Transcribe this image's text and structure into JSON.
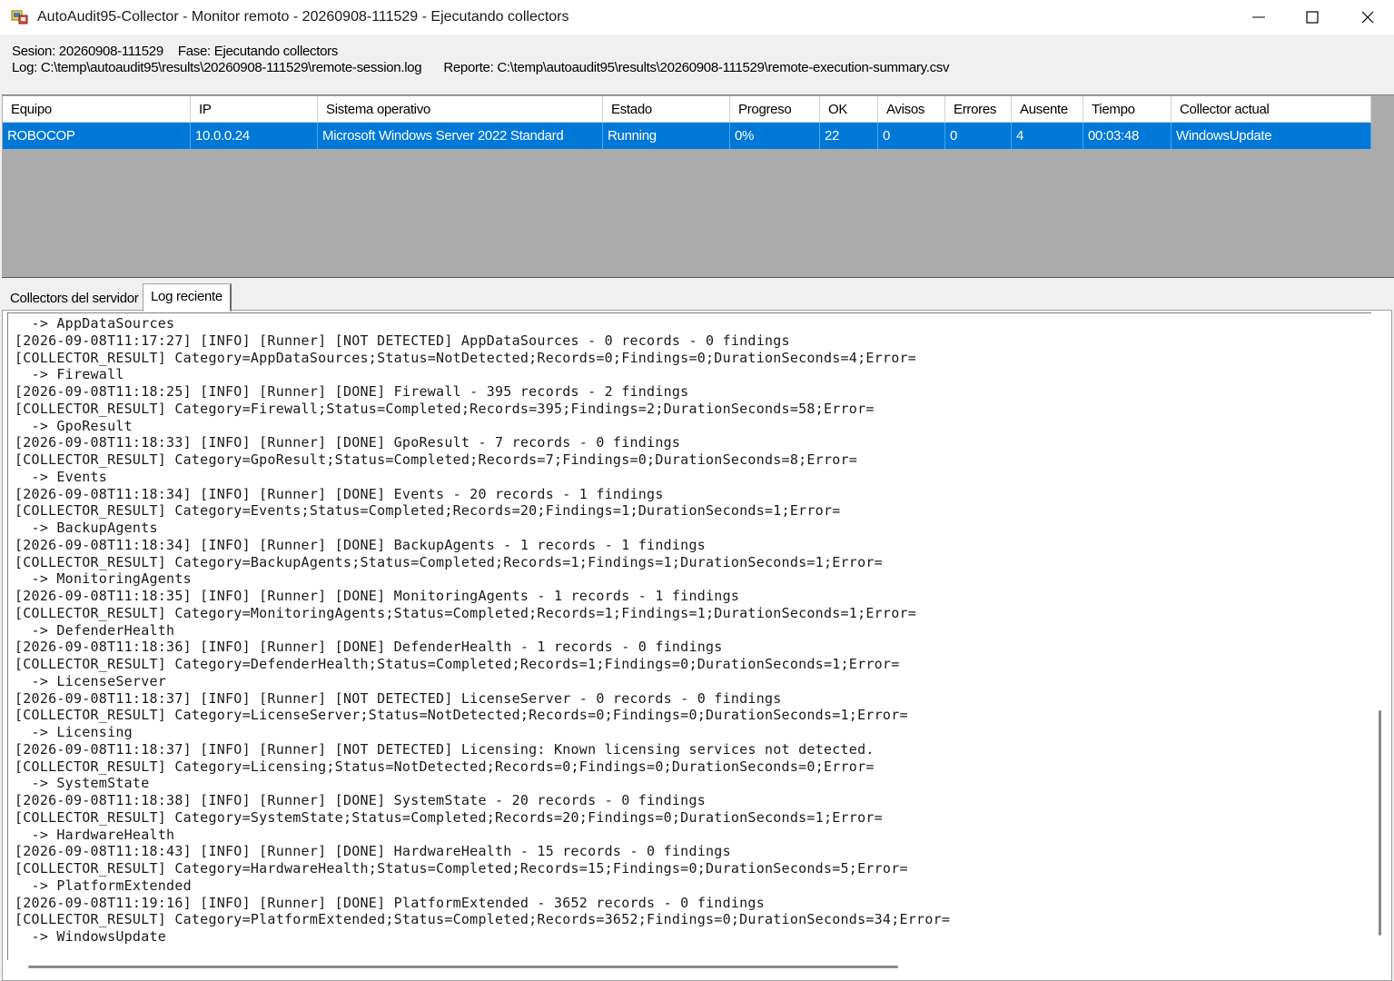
{
  "window": {
    "title": "AutoAudit95-Collector - Monitor remoto - 20260908-111529 - Ejecutando collectors",
    "controls": [
      "minimize",
      "maximize",
      "close"
    ]
  },
  "info": {
    "session_label": "Sesion: 20260908-111529",
    "phase_label": "Fase: Ejecutando collectors",
    "log_label": "Log: C:\\temp\\autoaudit95\\results\\20260908-111529\\remote-session.log",
    "report_label": "Reporte: C:\\temp\\autoaudit95\\results\\20260908-111529\\remote-execution-summary.csv"
  },
  "grid": {
    "columns": [
      "Equipo",
      "IP",
      "Sistema operativo",
      "Estado",
      "Progreso",
      "OK",
      "Avisos",
      "Errores",
      "Ausente",
      "Tiempo",
      "Collector actual"
    ],
    "rows": [
      [
        "ROBOCOP",
        "10.0.0.24",
        "Microsoft Windows Server 2022 Standard",
        "Running",
        "0%",
        "22",
        "0",
        "0",
        "4",
        "00:03:48",
        "WindowsUpdate"
      ]
    ],
    "selected_row": 0,
    "selection_color": "#0078d7"
  },
  "tabs": {
    "items": [
      "Collectors del servidor",
      "Log reciente"
    ],
    "active": 1
  },
  "log": {
    "lines": [
      "  -> AppDataSources",
      "[2026-09-08T11:17:27] [INFO] [Runner] [NOT DETECTED] AppDataSources - 0 records - 0 findings",
      "[COLLECTOR_RESULT] Category=AppDataSources;Status=NotDetected;Records=0;Findings=0;DurationSeconds=4;Error=",
      "  -> Firewall",
      "[2026-09-08T11:18:25] [INFO] [Runner] [DONE] Firewall - 395 records - 2 findings",
      "[COLLECTOR_RESULT] Category=Firewall;Status=Completed;Records=395;Findings=2;DurationSeconds=58;Error=",
      "  -> GpoResult",
      "[2026-09-08T11:18:33] [INFO] [Runner] [DONE] GpoResult - 7 records - 0 findings",
      "[COLLECTOR_RESULT] Category=GpoResult;Status=Completed;Records=7;Findings=0;DurationSeconds=8;Error=",
      "  -> Events",
      "[2026-09-08T11:18:34] [INFO] [Runner] [DONE] Events - 20 records - 1 findings",
      "[COLLECTOR_RESULT] Category=Events;Status=Completed;Records=20;Findings=1;DurationSeconds=1;Error=",
      "  -> BackupAgents",
      "[2026-09-08T11:18:34] [INFO] [Runner] [DONE] BackupAgents - 1 records - 1 findings",
      "[COLLECTOR_RESULT] Category=BackupAgents;Status=Completed;Records=1;Findings=1;DurationSeconds=1;Error=",
      "  -> MonitoringAgents",
      "[2026-09-08T11:18:35] [INFO] [Runner] [DONE] MonitoringAgents - 1 records - 1 findings",
      "[COLLECTOR_RESULT] Category=MonitoringAgents;Status=Completed;Records=1;Findings=1;DurationSeconds=1;Error=",
      "  -> DefenderHealth",
      "[2026-09-08T11:18:36] [INFO] [Runner] [DONE] DefenderHealth - 1 records - 0 findings",
      "[COLLECTOR_RESULT] Category=DefenderHealth;Status=Completed;Records=1;Findings=0;DurationSeconds=1;Error=",
      "  -> LicenseServer",
      "[2026-09-08T11:18:37] [INFO] [Runner] [NOT DETECTED] LicenseServer - 0 records - 0 findings",
      "[COLLECTOR_RESULT] Category=LicenseServer;Status=NotDetected;Records=0;Findings=0;DurationSeconds=1;Error=",
      "  -> Licensing",
      "[2026-09-08T11:18:37] [INFO] [Runner] [NOT DETECTED] Licensing: Known licensing services not detected.",
      "[COLLECTOR_RESULT] Category=Licensing;Status=NotDetected;Records=0;Findings=0;DurationSeconds=0;Error=",
      "  -> SystemState",
      "[2026-09-08T11:18:38] [INFO] [Runner] [DONE] SystemState - 20 records - 0 findings",
      "[COLLECTOR_RESULT] Category=SystemState;Status=Completed;Records=20;Findings=0;DurationSeconds=1;Error=",
      "  -> HardwareHealth",
      "[2026-09-08T11:18:43] [INFO] [Runner] [DONE] HardwareHealth - 15 records - 0 findings",
      "[COLLECTOR_RESULT] Category=HardwareHealth;Status=Completed;Records=15;Findings=0;DurationSeconds=5;Error=",
      "  -> PlatformExtended",
      "[2026-09-08T11:19:16] [INFO] [Runner] [DONE] PlatformExtended - 3652 records - 0 findings",
      "[COLLECTOR_RESULT] Category=PlatformExtended;Status=Completed;Records=3652;Findings=0;DurationSeconds=34;Error=",
      "  -> WindowsUpdate"
    ]
  }
}
